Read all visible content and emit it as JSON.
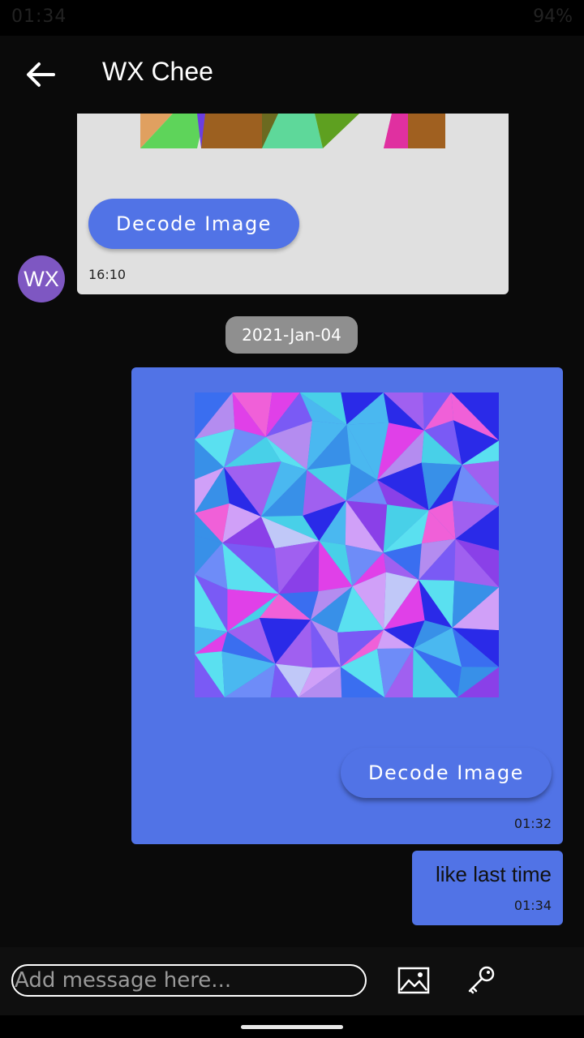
{
  "status": {
    "time": "01:34",
    "battery": "94%"
  },
  "header": {
    "title": "WX Chee",
    "back_icon": "arrow-left-icon"
  },
  "received": {
    "decode_label": "Decode Image",
    "time": "16:10",
    "avatar_initials": "WX"
  },
  "date_chip": "2021-Jan-04",
  "sent_image": {
    "decode_label": "Decode Image",
    "time": "01:32"
  },
  "sent_text": {
    "message": "like last time",
    "time": "01:34"
  },
  "composer": {
    "placeholder": "Add message here...",
    "image_icon": "image-icon",
    "key_icon": "key-icon"
  },
  "colors": {
    "bubble_blue": "#5173e6",
    "avatar": "#7e57c2",
    "received_bg": "#e0e0e0"
  }
}
